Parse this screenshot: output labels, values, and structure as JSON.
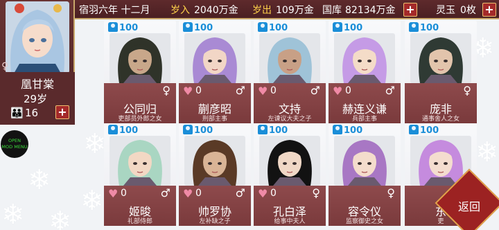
{
  "topbar": {
    "date": "宿羽六年 十二月",
    "income_label": "岁入",
    "income_value": "2040万金",
    "expense_label": "岁出",
    "expense_value": "109万金",
    "treasury_label": "国库",
    "treasury_value": "82134万金",
    "jade_label": "灵玉",
    "jade_value": "0枚",
    "plus": "+"
  },
  "hero": {
    "name": "凰甘棠",
    "age": "29岁",
    "count": "16",
    "gender": "♀",
    "plus": "+"
  },
  "mod_menu": {
    "line1": "OPEN",
    "line2": "MOD MENU"
  },
  "back_button": "返回",
  "colors": {
    "bar": "#4a1f22",
    "accent": "#ffd24a",
    "card_band": "#8e4a4c",
    "favor": "#1a8ed8"
  },
  "cards": [
    {
      "favor": "100",
      "hearts": "",
      "name": "公同归",
      "title": "吏部员外郎之女",
      "gender": "♀",
      "hair": "#2f3329",
      "skin": "#c8a78a"
    },
    {
      "favor": "100",
      "hearts": "0",
      "name": "蒯彦昭",
      "title": "刑部主事",
      "gender": "♂",
      "hair": "#a98ad4",
      "skin": "#f2d6c6"
    },
    {
      "favor": "100",
      "hearts": "0",
      "name": "文持",
      "title": "左谏议大夫之子",
      "gender": "♂",
      "hair": "#9fc3d8",
      "skin": "#c8a086"
    },
    {
      "favor": "100",
      "hearts": "0",
      "name": "赫连义谦",
      "title": "兵部主事",
      "gender": "♂",
      "hair": "#c59be6",
      "skin": "#f4dcc8"
    },
    {
      "favor": "100",
      "hearts": "",
      "name": "庞非",
      "title": "通事舍人之女",
      "gender": "♀",
      "hair": "#2f3a34",
      "skin": "#e2c4ac"
    },
    {
      "favor": "100",
      "hearts": "0",
      "name": "姬晙",
      "title": "礼部侍郎",
      "gender": "♂",
      "hair": "#a9d6c2",
      "skin": "#f2d8c4"
    },
    {
      "favor": "100",
      "hearts": "0",
      "name": "帅罗协",
      "title": "左补缺之子",
      "gender": "♂",
      "hair": "#5a3a26",
      "skin": "#d9b496"
    },
    {
      "favor": "100",
      "hearts": "0",
      "name": "孔白泽",
      "title": "给事中夫人",
      "gender": "♀",
      "hair": "#121212",
      "skin": "#f0d8c6"
    },
    {
      "favor": "100",
      "hearts": "",
      "name": "容令仪",
      "title": "监察御史之女",
      "gender": "♀",
      "hair": "#a877c4",
      "skin": "#f4dccc"
    },
    {
      "favor": "100",
      "hearts": "",
      "name": "东",
      "title": "吏",
      "gender": "",
      "hair": "#c58bde",
      "skin": "#f4ddcf"
    }
  ]
}
